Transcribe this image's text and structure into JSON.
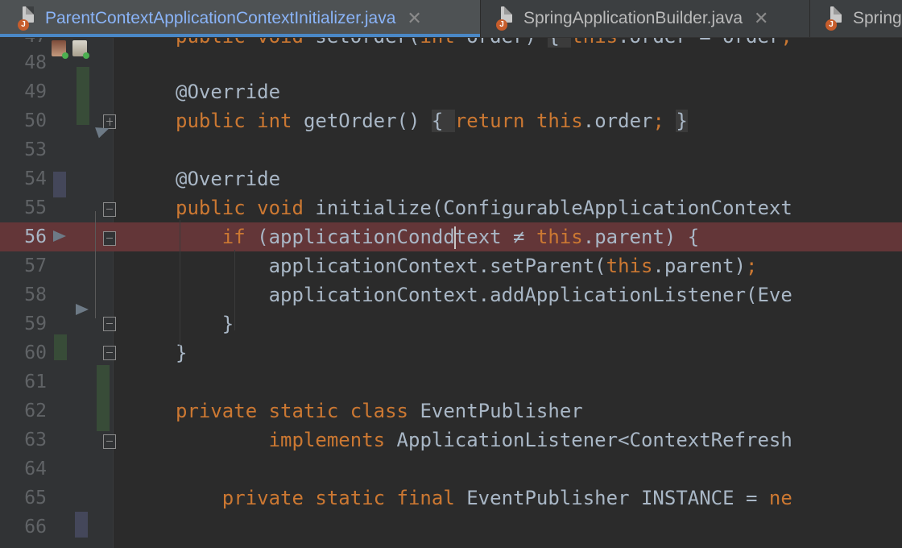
{
  "tabs": [
    {
      "label": "ParentContextApplicationContextInitializer.java",
      "active": true,
      "close": "✕"
    },
    {
      "label": "SpringApplicationBuilder.java",
      "active": false,
      "close": "✕"
    },
    {
      "label": "Spring",
      "active": false,
      "close": ""
    }
  ],
  "editor": {
    "lines": [
      {
        "n": "48",
        "html": ""
      },
      {
        "n": "49",
        "html": "<span class=\"ann-plain\">@Override</span>"
      },
      {
        "n": "50",
        "html": "<span class=\"kw\">public int </span>getOrder() <span class=\"fold-bg\">{ </span><span class=\"kw\">return this</span>.order<span class=\"kw\">; </span><span class=\"fold-bg\">}</span>"
      },
      {
        "n": "53",
        "html": ""
      },
      {
        "n": "54",
        "html": "<span class=\"ann-plain\">@Override</span>"
      },
      {
        "n": "55",
        "html": "<span class=\"kw\">public void </span>initialize(ConfigurableApplicationContext"
      },
      {
        "n": "56",
        "html": "    <span class=\"kw\">if </span>(applicationCondd<span class=\"caret\"></span>text ≠ <span class=\"kw\">this</span>.parent) {",
        "breakpoint": true
      },
      {
        "n": "57",
        "html": "        applicationContext.setParent(<span class=\"kw\">this</span>.parent)<span class=\"kw\">;</span>"
      },
      {
        "n": "58",
        "html": "        applicationContext.addApplicationListener(Eve"
      },
      {
        "n": "59",
        "html": "    }"
      },
      {
        "n": "60",
        "html": "}"
      },
      {
        "n": "61",
        "html": ""
      },
      {
        "n": "62",
        "html": "<span class=\"kw\">private static class </span>EventPublisher"
      },
      {
        "n": "63",
        "html": "        <span class=\"kw\">implements </span>ApplicationListener&lt;ContextRefresh"
      },
      {
        "n": "64",
        "html": ""
      },
      {
        "n": "65",
        "html": "    <span class=\"kw\">private static final </span>EventPublisher INSTANCE = <span class=\"kw\">ne</span>"
      },
      {
        "n": "66",
        "html": ""
      }
    ],
    "top_partial_line": "<span class=\"kw\">public void </span>setOrder(<span class=\"kw\">int </span>order) <span class=\"fold-bg\">{ </span><span class=\"kw\">this</span>.order = order<span class=\"kw\">;</span>",
    "bottom_partial_line": "    <span class=\"ann-plain\">@Override</span>"
  },
  "colors": {
    "background": "#2b2b2b",
    "gutter": "#313335",
    "keyword": "#cc7832",
    "text": "#a9b7c6",
    "breakpoint_line": "#633638",
    "active_tab_text": "#8ab4f8",
    "active_tab_underline": "#4a88c7"
  },
  "icons": {
    "tab_file": "java-class-file-icon",
    "fold_collapse": "fold-minus-icon",
    "fold_expand": "fold-plus-icon",
    "execution_pointer": "execution-arrow-icon",
    "authors": "author-avatar-icon"
  }
}
